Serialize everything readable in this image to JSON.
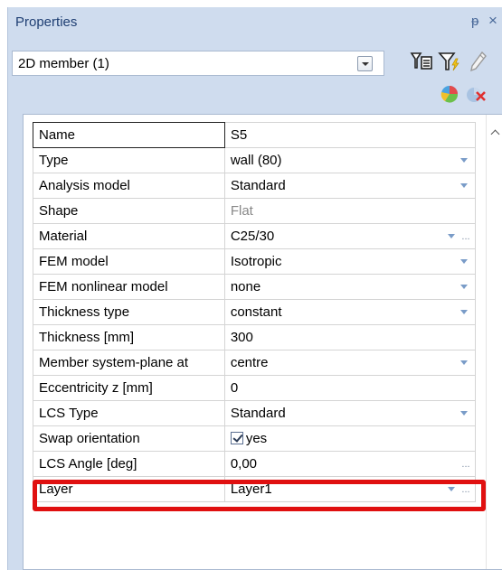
{
  "panel": {
    "title": "Properties",
    "pin_glyph": "ᵽ",
    "close_glyph": "×"
  },
  "selector": {
    "value": "2D member (1)"
  },
  "toolbar": {
    "icons": [
      "select-filter-icon",
      "filter-lightning-icon",
      "pencil-icon",
      "pie-chart-icon",
      "remove-chart-icon"
    ]
  },
  "properties": [
    {
      "name": "Name",
      "value": "S5"
    },
    {
      "name": "Type",
      "value": "wall (80)"
    },
    {
      "name": "Analysis model",
      "value": "Standard"
    },
    {
      "name": "Shape",
      "value": "Flat"
    },
    {
      "name": "Material",
      "value": "C25/30"
    },
    {
      "name": "FEM model",
      "value": "Isotropic"
    },
    {
      "name": "FEM nonlinear model",
      "value": "none"
    },
    {
      "name": "Thickness type",
      "value": "constant"
    },
    {
      "name": "Thickness [mm]",
      "value": "300"
    },
    {
      "name": "Member system-plane at",
      "value": "centre"
    },
    {
      "name": "Eccentricity z [mm]",
      "value": "0"
    },
    {
      "name": "LCS Type",
      "value": "Standard"
    },
    {
      "name": "Swap orientation",
      "value": "yes",
      "checked": true
    },
    {
      "name": "LCS Angle [deg]",
      "value": "0,00"
    },
    {
      "name": "Layer",
      "value": "Layer1"
    }
  ],
  "colors": {
    "panel_bg": "#cfdcee",
    "title": "#1f3f73",
    "highlight": "#e01010"
  }
}
